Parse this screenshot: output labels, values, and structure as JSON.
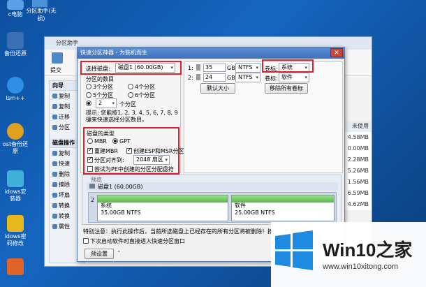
{
  "desktop": {
    "icons": [
      {
        "label": "c电脑",
        "color": "#5aa0e6"
      },
      {
        "label": "备份还原",
        "color": "#3a6fb5"
      },
      {
        "label": "lsm++",
        "color": "#2f8ee8"
      },
      {
        "label": "ost备份还\n原",
        "color": "#e0a020"
      },
      {
        "label": "idows安\n装器",
        "color": "#3fb0d8"
      },
      {
        "label": "idows密\n码修改",
        "color": "#e6b81e"
      },
      {
        "label": "",
        "color": "#e0642a"
      }
    ],
    "top_icon_label": "分区助手(无\n损)"
  },
  "bg_window": {
    "title": "分区助手",
    "toolbar_label": "提交",
    "sidebar": {
      "section1": "向导",
      "items1": [
        "复制",
        "复制",
        "迁移",
        "分区"
      ],
      "section2": "磁盘操作",
      "items2": [
        "复制",
        "快速",
        "删除",
        "擦除",
        "坏扇",
        "转换",
        "转换",
        "属性"
      ]
    },
    "right_col": [
      "未使用",
      "4.58MB",
      "0.00MB",
      "2.28MB",
      "5.26MB",
      "1.56MB",
      "6.59MB",
      "4.62MB"
    ]
  },
  "dialog": {
    "title": "快速分区神器 - 为装机而生",
    "select_disk_label": "选择磁盘:",
    "select_disk_value": "磁盘1 (60.00GB)",
    "partition_count_label": "分区的数目",
    "radios": [
      "3个分区",
      "4个分区",
      "5个分区",
      "6个分区"
    ],
    "custom_count": "2",
    "custom_suffix": "个分区",
    "tip": "提示: 您能按1, 2, 3, 4, 5, 6, 7, 8, 9键来快速选择分区数目。",
    "disk_type_label": "磁盘的类型",
    "mbr_label": "MBR",
    "gpt_label": "GPT",
    "rebuild_mbr": "重建MBR",
    "create_esp": "创建ESP和MSR分区",
    "align_label": "分区对齐到:",
    "align_value": "2048 扇区",
    "pe_hide": "尝试为PE中创建的分区分配盘符",
    "row1": {
      "num": "1:",
      "size": "35",
      "unit": "GB",
      "fs": "NTFS"
    },
    "row2": {
      "num": "2:",
      "size": "24",
      "unit": "GB",
      "fs": "NTFS"
    },
    "default_size_btn": "默认大小",
    "volume_label": "卷标:",
    "volume1": "系统",
    "volume2": "软件",
    "clear_labels_btn": "移除所有卷标",
    "preview_label": "预览",
    "disk_title": "磁盘1 (60.00GB)",
    "part1_name": "系统",
    "part1_info": "35.00GB NTFS",
    "part2_name": "软件",
    "part2_info": "25.00GB NTFS",
    "row_num": "2",
    "warning": "特别注意：执行此操作后，当前所选磁盘上已经存在的所有分区将被删除！按",
    "startup_check": "下次启动软件时直接进入快速分区窗口",
    "preset_btn": "预设置"
  },
  "watermark": {
    "brand": "Win10",
    "brand_suffix": "之家",
    "url": "www.win10xitong.com",
    "accent": "#1f8be0"
  },
  "colors": {
    "highlight": "#e0202c",
    "title_bar": "#3e72bd"
  }
}
